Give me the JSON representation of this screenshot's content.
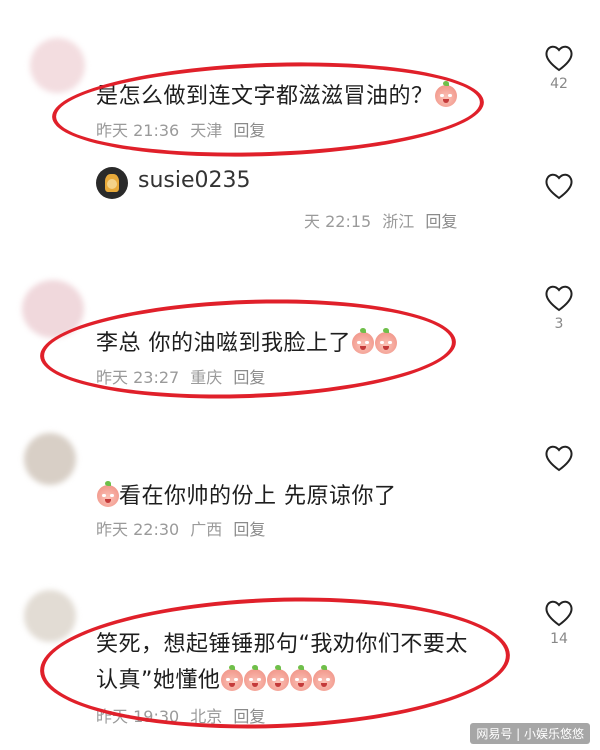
{
  "comments": [
    {
      "text": "是怎么做到连文字都滋滋冒油的？",
      "time": "昨天 21:36",
      "location": "天津",
      "reply": "回复",
      "likes": "42"
    },
    {
      "username": "susie0235",
      "time": "天 22:15",
      "location": "浙江",
      "reply": "回复"
    },
    {
      "text": "李总  你的油嗞到我脸上了",
      "time": "昨天 23:27",
      "location": "重庆",
      "reply": "回复",
      "likes": "3"
    },
    {
      "text": "看在你帅的份上 先原谅你了",
      "time": "昨天 22:30",
      "location": "广西",
      "reply": "回复"
    },
    {
      "text_line1": "笑死，想起锤锤那句“我劝你们不要太",
      "text_line2": "认真”她懂他",
      "time": "昨天 19:30",
      "location": "北京",
      "reply": "回复",
      "likes": "14"
    }
  ],
  "watermark": "网易号 | 小娱乐悠悠",
  "colors": {
    "circle": "#e0202a",
    "meta": "#9a9a9a",
    "text": "#1e1e1e"
  },
  "icons": [
    "heart-outline-icon",
    "crying-emoji-icon",
    "angry-emoji-icon"
  ]
}
